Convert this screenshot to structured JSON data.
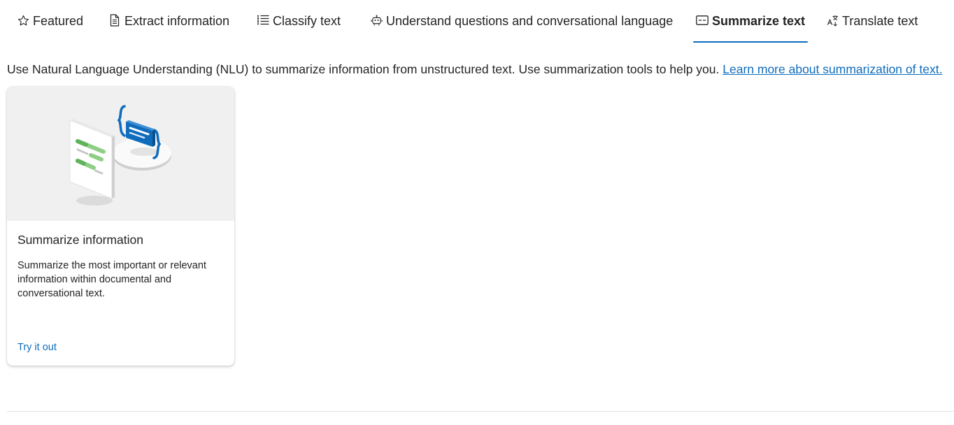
{
  "tabs": [
    {
      "label": "Featured",
      "icon": "star-icon",
      "active": false
    },
    {
      "label": "Extract information",
      "icon": "document-icon",
      "active": false
    },
    {
      "label": "Classify text",
      "icon": "list-icon",
      "active": false
    },
    {
      "label": "Understand questions and conversational language",
      "icon": "bot-icon",
      "active": false
    },
    {
      "label": "Summarize text",
      "icon": "summary-icon",
      "active": true
    },
    {
      "label": "Translate text",
      "icon": "translate-icon",
      "active": false
    }
  ],
  "description": {
    "text": "Use Natural Language Understanding (NLU) to summarize information from unstructured text. Use summarization tools to help you. ",
    "link_label": "Learn more about summarization of text."
  },
  "card": {
    "title": "Summarize information",
    "description": "Summarize the most important or relevant information within documental and conversational text.",
    "action_label": "Try it out"
  },
  "colors": {
    "accent": "#0f6cbd",
    "hero_background": "#f0f0f0",
    "text": "#242424"
  }
}
